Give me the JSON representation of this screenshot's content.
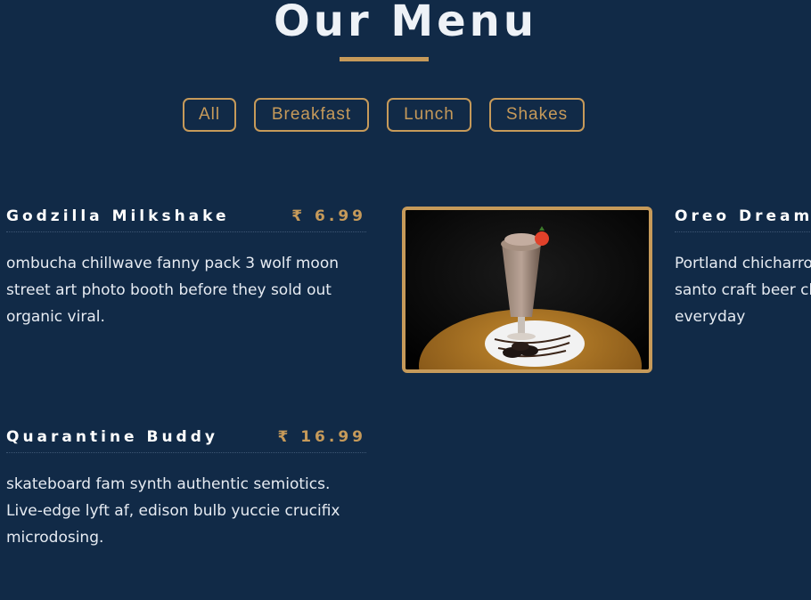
{
  "page": {
    "title": "Our Menu"
  },
  "filters": [
    {
      "label": "All"
    },
    {
      "label": "Breakfast"
    },
    {
      "label": "Lunch"
    },
    {
      "label": "Shakes"
    }
  ],
  "items": [
    {
      "name": "Godzilla Milkshake",
      "price": "₹ 6.99",
      "description": "ombucha chillwave fanny pack 3 wolf moon street art photo booth before they sold out organic viral."
    },
    {
      "name": "Oreo Dream",
      "price": "",
      "description": "Portland chicharrones ethical edison bulb, palo santo craft beer chia heirloom iPhone everyday"
    },
    {
      "name": "Quarantine Buddy",
      "price": "₹ 16.99",
      "description": "skateboard fam synth authentic semiotics. Live-edge lyft af, edison bulb yuccie crucifix microdosing."
    }
  ],
  "colors": {
    "background": "#112a47",
    "accent": "#c69a5a",
    "text": "#e6ebf2"
  }
}
